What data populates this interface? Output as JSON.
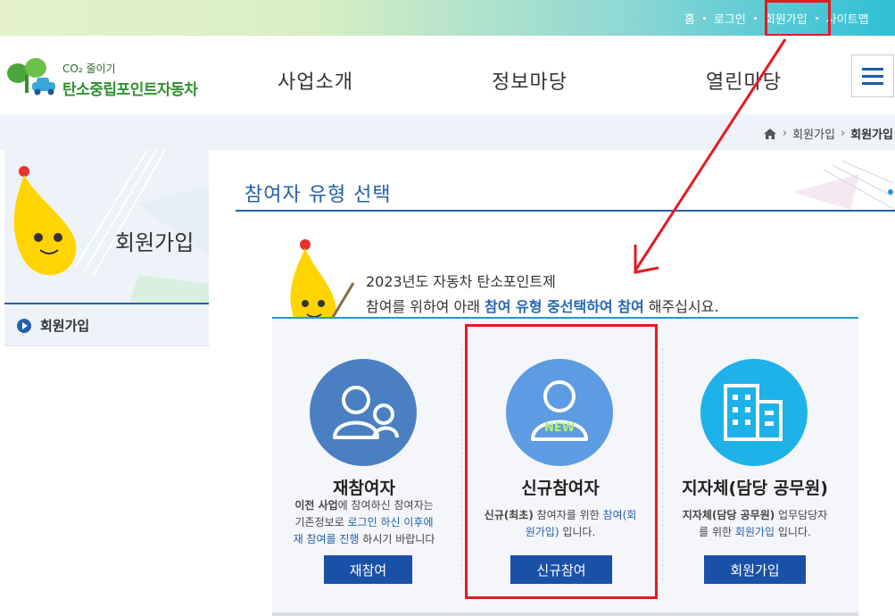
{
  "util_nav": {
    "home": "홈",
    "login": "로그인",
    "join": "회원가입",
    "sitemap": "사이트맵"
  },
  "logo": {
    "small": "CO₂ 줄이기",
    "big": "탄소중립포인트자동차"
  },
  "gnb": [
    "사업소개",
    "정보마당",
    "열린마당"
  ],
  "breadcrumb": {
    "parent": "회원가입",
    "current": "회원가입"
  },
  "sidebar": {
    "title": "회원가입",
    "menu_item": "회원가입"
  },
  "content": {
    "title": "참여자 유형 선택",
    "intro_line1": "2023년도 자동차 탄소포인트제",
    "intro_line2_pre": "참여를 위하여 아래 ",
    "intro_line2_bold": "참여 유형 중선택하여 참여",
    "intro_line2_post": " 해주십시요."
  },
  "cards": [
    {
      "title": "재참여자",
      "desc_l1_bold": "이전 사업",
      "desc_l1_rest": "에 참여하신 참여자는",
      "desc_l2_pre": "기존정보로 ",
      "desc_l2_hl": "로그인 하신 이후에",
      "desc_l3_hl": "재 참여를 진행",
      "desc_l3_post": " 하시기 바랍니다",
      "button": "재참여",
      "color": "#4a80c2"
    },
    {
      "title": "신규참여자",
      "badge": "NEW",
      "desc_l1_pre": "신규(최초)",
      "desc_l1_mid": " 참여자를 위한 ",
      "desc_l1_hl": "참여(회",
      "desc_l2_hl": "원가입)",
      "desc_l2_post": " 입니다.",
      "button": "신규참여",
      "color": "#5d9be2"
    },
    {
      "title": "지자체(담당 공무원)",
      "desc_l1_bold": "지자체(담당 공무원)",
      "desc_l1_rest": " 업무담당자",
      "desc_l2_pre": "를 위한 ",
      "desc_l2_hl": "회원가입",
      "desc_l2_post": " 입니다.",
      "button": "회원가입",
      "color": "#1fb2e8"
    }
  ],
  "colors": {
    "highlight_box": "#e21b23",
    "primary_blue": "#1951a7"
  }
}
